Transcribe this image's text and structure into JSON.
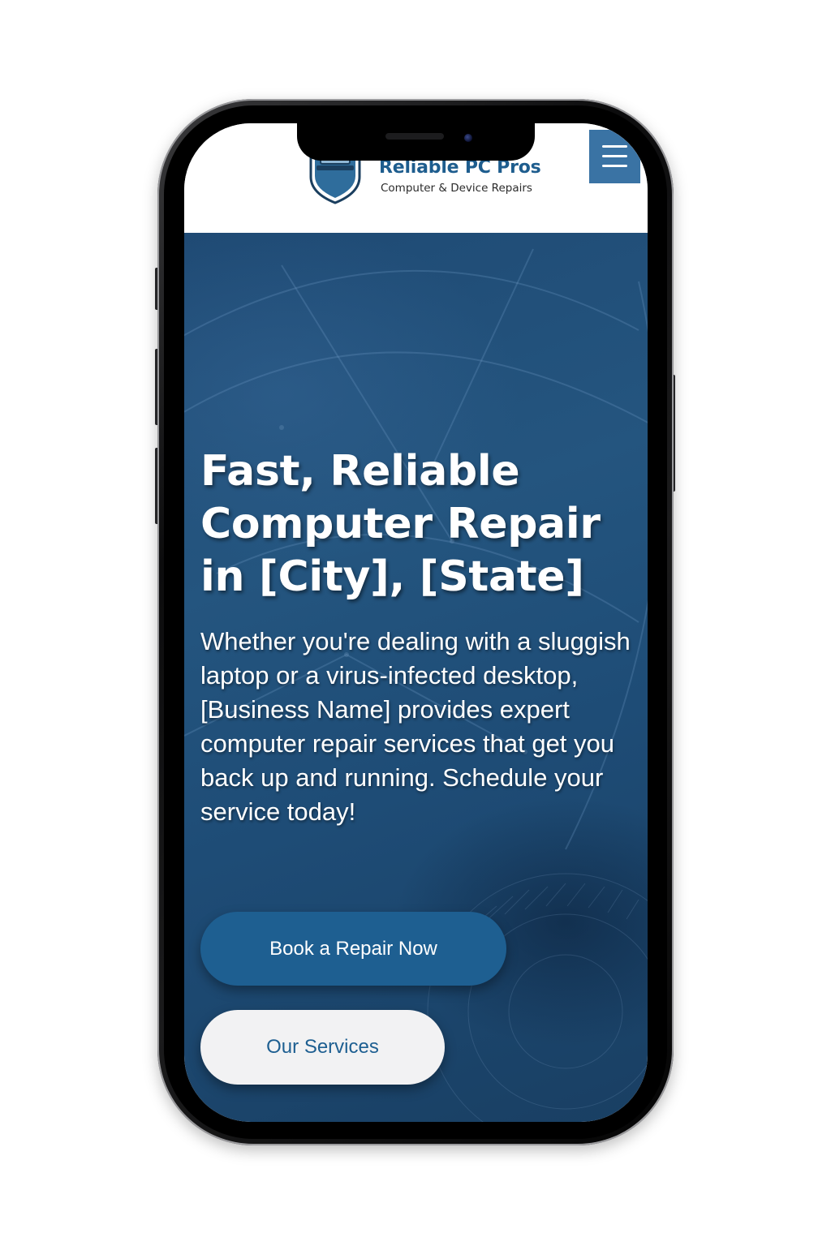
{
  "header": {
    "brand_name": "Reliable PC Pros",
    "tagline": "Computer & Device Repairs",
    "menu_icon": "hamburger-menu-icon"
  },
  "hero": {
    "title": "Fast, Reliable Computer Repair in [City], [State]",
    "description": "Whether you're dealing with a sluggish laptop or a virus-infected desktop, [Business Name] provides expert computer repair services that get you back up and running. Schedule your service today!",
    "primary_button": "Book a Repair Now",
    "secondary_button": "Our Services"
  },
  "colors": {
    "brand": "#1e5d8e",
    "menu_button": "#3a73a4",
    "hero_background": "#224f7a",
    "primary_button": "#1e5f91",
    "secondary_button": "#f2f2f3"
  }
}
